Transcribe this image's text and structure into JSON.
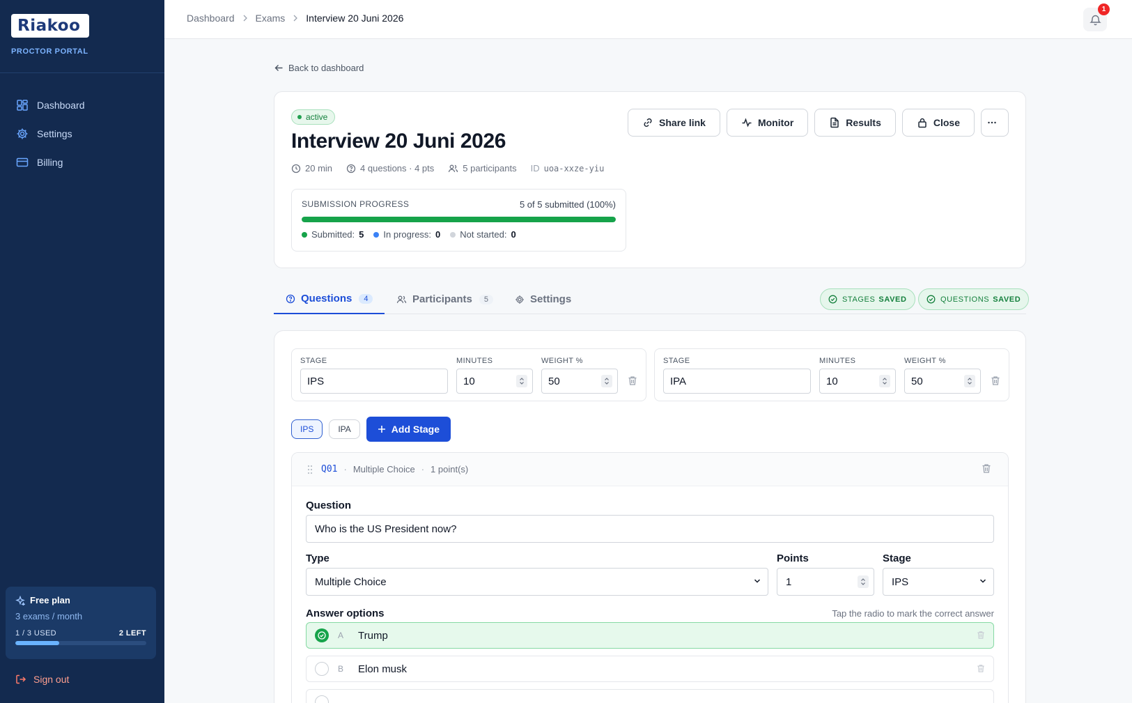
{
  "sidebar": {
    "logo": "Riakoo",
    "portal_label": "PROCTOR PORTAL",
    "nav": [
      {
        "label": "Dashboard",
        "icon": "dashboard-icon"
      },
      {
        "label": "Settings",
        "icon": "gear-icon"
      },
      {
        "label": "Billing",
        "icon": "credit-card-icon"
      }
    ],
    "plan": {
      "title": "Free plan",
      "subtitle": "3 exams / month",
      "used_label": "1 / 3 USED",
      "left_label": "2 LEFT",
      "used_fraction": 0.333
    },
    "signout_label": "Sign out"
  },
  "topbar": {
    "breadcrumb": [
      "Dashboard",
      "Exams",
      "Interview 20 Juni 2026"
    ],
    "notification_count": "1"
  },
  "main": {
    "back_label": "Back to dashboard",
    "exam": {
      "status": "active",
      "title": "Interview 20 Juni 2026",
      "duration": "20 min",
      "questions": "4 questions · 4 pts",
      "participants": "5 participants",
      "id_label": "ID",
      "id": "uoa-xxze-yiu",
      "actions": {
        "share": "Share link",
        "monitor": "Monitor",
        "results": "Results",
        "close": "Close"
      },
      "progress": {
        "label": "SUBMISSION PROGRESS",
        "value": "5 of 5 submitted (100%)",
        "fraction": 1.0,
        "submitted_label": "Submitted:",
        "submitted": "5",
        "in_progress_label": "In progress:",
        "in_progress": "0",
        "not_started_label": "Not started:",
        "not_started": "0"
      }
    },
    "tabs": [
      {
        "label": "Questions",
        "count": "4",
        "active": true
      },
      {
        "label": "Participants",
        "count": "5",
        "active": false
      },
      {
        "label": "Settings",
        "count": "",
        "active": false
      }
    ],
    "saved": {
      "stages_word": "STAGES",
      "questions_word": "QUESTIONS",
      "saved_word": "SAVED"
    },
    "stages": [
      {
        "stage_label": "STAGE",
        "minutes_label": "MINUTES",
        "weight_label": "WEIGHT %",
        "name": "IPS",
        "minutes": "10",
        "weight": "50"
      },
      {
        "stage_label": "STAGE",
        "minutes_label": "MINUTES",
        "weight_label": "WEIGHT %",
        "name": "IPA",
        "minutes": "10",
        "weight": "50"
      }
    ],
    "stage_chips": [
      "IPS",
      "IPA"
    ],
    "add_stage_label": "Add Stage",
    "question": {
      "code": "Q01",
      "type_summary": "Multiple Choice",
      "points_summary": "1 point(s)",
      "question_label": "Question",
      "question_text": "Who is the US President now?",
      "type_label": "Type",
      "type_value": "Multiple Choice",
      "points_label": "Points",
      "points_value": "1",
      "stage_label": "Stage",
      "stage_value": "IPS",
      "answers_label": "Answer options",
      "answers_hint": "Tap the radio to mark the correct answer",
      "options": [
        {
          "letter": "A",
          "text": "Trump",
          "correct": true
        },
        {
          "letter": "B",
          "text": "Elon musk",
          "correct": false
        }
      ]
    }
  }
}
